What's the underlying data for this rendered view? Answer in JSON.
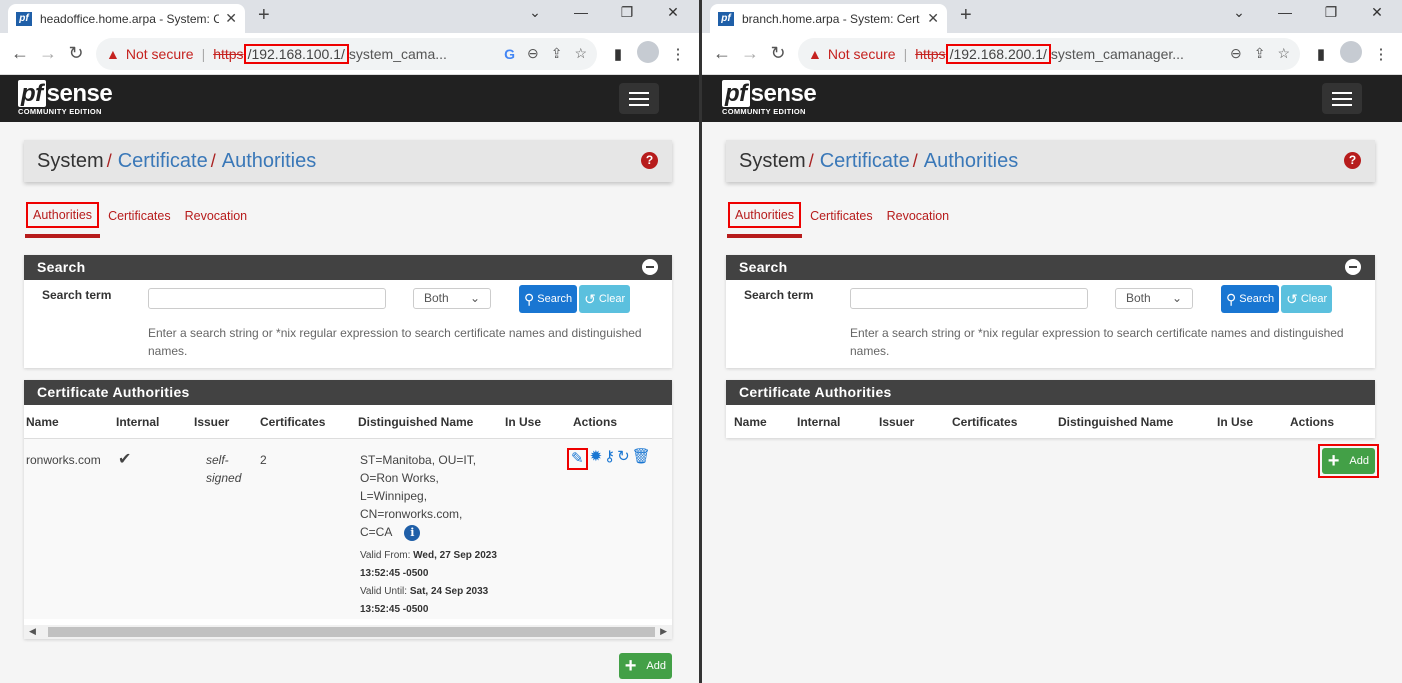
{
  "windows": [
    {
      "tab_title": "headoffice.home.arpa - System: C",
      "favicon": "pf",
      "url": {
        "warning": "Not secure",
        "scheme": "https",
        "host": "/192.168.100.1/",
        "path": "system_cama..."
      },
      "logo": {
        "main": "sense",
        "pf": "pf",
        "sub": "COMMUNITY EDITION"
      },
      "breadcrumb": {
        "root": "System",
        "mid": "Certificate",
        "leaf": "Authorities"
      },
      "tabs": [
        "Authorities",
        "Certificates",
        "Revocation"
      ],
      "search": {
        "title": "Search",
        "label": "Search term",
        "value": "",
        "select": "Both",
        "search_btn": "Search",
        "clear_btn": "Clear",
        "help": "Enter a search string or *nix regular expression to search certificate names and distinguished names."
      },
      "ca": {
        "title": "Certificate Authorities",
        "columns": [
          "Name",
          "Internal",
          "Issuer",
          "Certificates",
          "Distinguished Name",
          "In Use",
          "Actions"
        ],
        "rows": [
          {
            "name": "ronworks.com",
            "internal": "✔",
            "issuer": "self-signed",
            "certificates": "2",
            "dn": [
              "ST=Manitoba, OU=IT,",
              "O=Ron Works,",
              "L=Winnipeg,",
              "CN=ronworks.com,",
              "C=CA"
            ],
            "valid_from_label": "Valid From:",
            "valid_from": "Wed, 27 Sep 2023 13:52:45 -0500",
            "valid_until_label": "Valid Until:",
            "valid_until": "Sat, 24 Sep 2033 13:52:45 -0500",
            "in_use": ""
          }
        ]
      },
      "add_btn": "Add"
    },
    {
      "tab_title": "branch.home.arpa - System: Cert",
      "favicon": "pf",
      "url": {
        "warning": "Not secure",
        "scheme": "https",
        "host": "/192.168.200.1/",
        "path": "system_camanager..."
      },
      "logo": {
        "main": "sense",
        "pf": "pf",
        "sub": "COMMUNITY EDITION"
      },
      "breadcrumb": {
        "root": "System",
        "mid": "Certificate",
        "leaf": "Authorities"
      },
      "tabs": [
        "Authorities",
        "Certificates",
        "Revocation"
      ],
      "search": {
        "title": "Search",
        "label": "Search term",
        "value": "",
        "select": "Both",
        "search_btn": "Search",
        "clear_btn": "Clear",
        "help": "Enter a search string or *nix regular expression to search certificate names and distinguished names."
      },
      "ca": {
        "title": "Certificate Authorities",
        "columns": [
          "Name",
          "Internal",
          "Issuer",
          "Certificates",
          "Distinguished Name",
          "In Use",
          "Actions"
        ],
        "rows": []
      },
      "add_btn": "Add"
    }
  ]
}
